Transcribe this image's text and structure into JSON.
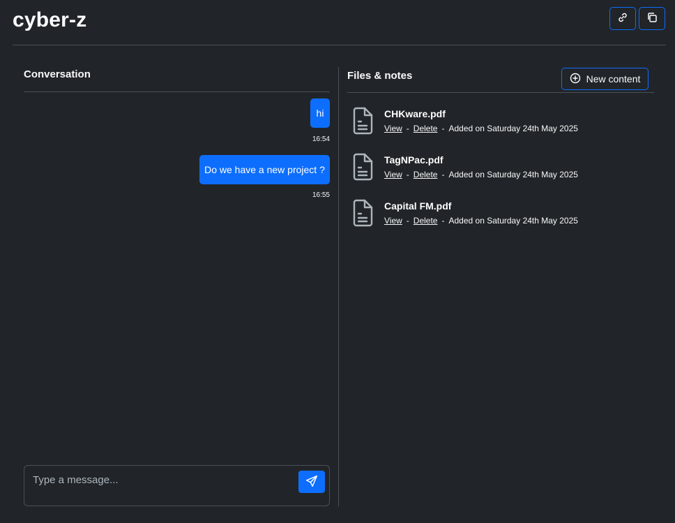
{
  "app": {
    "title": "cyber-z"
  },
  "header": {
    "link_icon": "link-icon",
    "copy_icon": "copy-icon"
  },
  "conversation": {
    "title": "Conversation",
    "messages": [
      {
        "text": "hi",
        "time": "16:54"
      },
      {
        "text": "Do we have a new project ?",
        "time": "16:55"
      }
    ],
    "input": {
      "placeholder": "Type a message...",
      "value": ""
    },
    "send_icon": "send-icon"
  },
  "files": {
    "title": "Files & notes",
    "new_button_label": "New content",
    "new_button_icon": "plus-circle-icon",
    "items": [
      {
        "name": "CHKware.pdf",
        "view": "View",
        "delete": "Delete",
        "added": "Added on Saturday 24th May 2025",
        "icon": "file-text-icon"
      },
      {
        "name": "TagNPac.pdf",
        "view": "View",
        "delete": "Delete",
        "added": "Added on Saturday 24th May 2025",
        "icon": "file-text-icon"
      },
      {
        "name": "Capital FM.pdf",
        "view": "View",
        "delete": "Delete",
        "added": "Added on Saturday 24th May 2025",
        "icon": "file-text-icon"
      }
    ],
    "separator": "-"
  },
  "colors": {
    "background": "#212529",
    "accent": "#0d6efd",
    "border": "#495057",
    "text": "#f8f9fa"
  }
}
